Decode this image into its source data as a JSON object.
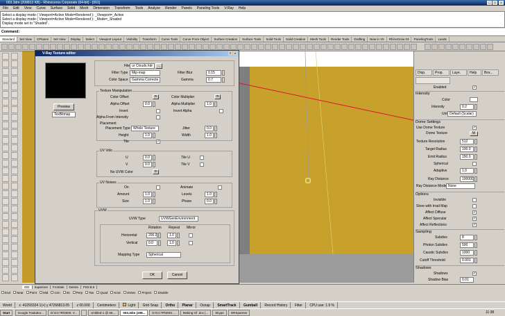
{
  "window": {
    "title": "003.3dm (208813 KB) - Rhinoceros Corporate (64-bit) - [001]"
  },
  "menu": [
    "File",
    "Edit",
    "View",
    "Curve",
    "Surface",
    "Solid",
    "Mesh",
    "Dimension",
    "Transform",
    "Tools",
    "Analyze",
    "Render",
    "Panels",
    "Paneling Tools",
    "V-Ray",
    "Help"
  ],
  "command": {
    "history": [
      "Select a display mode ( Viewport=Active  Mode=Rendered ): _Viewport=_Active",
      "Select a display mode ( Viewport=Active  Mode=Rendered ): _Mode=_Shaded",
      "Display mode set to \"Shaded\"."
    ],
    "prompt": "Command:"
  },
  "tabs": [
    "Standard",
    "Set View",
    "CPlanes",
    "Set View",
    "Display",
    "Select",
    "Viewport Layout",
    "Visibility",
    "Transform",
    "Curve Tools",
    "Curve From Object",
    "Surface Creation",
    "Surface Tools",
    "Solid Tools",
    "Solid Creation",
    "Mesh Tools",
    "Render Tools",
    "Drafting",
    "New in V5",
    "RhinoGrow 03",
    "PanelingTools",
    "Lands"
  ],
  "dialog": {
    "title": "V-Ray Texture editor",
    "preview_label": "Preview",
    "type_value": "TexBitmap",
    "file_label": "File",
    "file_value": "ur Clouds.hdr",
    "browse_label": "...",
    "filter_type_label": "Filter Type",
    "filter_type_value": "Mip-map",
    "filter_blur_label": "Filter Blur",
    "filter_blur_value": "0.15",
    "color_space_label": "Color Space",
    "color_space_value": "Gamma Correcte",
    "gamma_label": "Gamma",
    "gamma_value": "0.7",
    "tex_manip": "Texture Manipulation",
    "color_offset": "Color Offset",
    "color_multiplier": "Color Multiplier",
    "alpha_offset": "Alpha Offset",
    "alpha_offset_value": "0.0",
    "alpha_multiplier": "Alpha Multiplier",
    "alpha_multiplier_value": "1.0",
    "invert": "Invert",
    "invert_alpha": "Invert Alpha",
    "alpha_from_intensity": "Alpha From Intensity",
    "placement": "Placement",
    "placement_type_label": "Placement Type",
    "placement_type_value": "Whole Texture",
    "jitter_label": "Jitter",
    "jitter_value": "0.0",
    "height_label": "Height",
    "height_value": "1.0",
    "width_label": "Width",
    "width_value": "1.0",
    "tile_label": "Tile",
    "uv_volo": "UV Volo",
    "u_label": "U",
    "u_value": "0.0",
    "tile_u": "Tile U",
    "v_label": "V",
    "v_value": "0.0",
    "tile_v": "Tile V",
    "w_label": "W",
    "no_uvw_color": "No UVW Color",
    "m_label": "m",
    "uv_noises": "UV Noises",
    "on_label": "On",
    "animate_label": "Animate",
    "amount_label": "Amount",
    "amount_value": "1.0",
    "levels_label": "Levels",
    "levels_value": "1.0",
    "size_label": "Size",
    "size_value": "1.0",
    "phase_label": "Phase",
    "phase_value": "0.0",
    "uvw": "UVW",
    "uvw_type_label": "UVW Type",
    "uvw_type_value": "UVWGenEnvironment",
    "rotation": "Rotation",
    "repeat": "Repeat",
    "mirror": "Mirror",
    "horizontal": "Horizontal",
    "horizontal_rot": "200.0",
    "horizontal_rep": "1.0",
    "vertical": "Vertical",
    "vertical_rot": "0.0",
    "vertical_rep": "1.0",
    "mapping_type_label": "Mapping Type",
    "mapping_type_value": "Spherical",
    "ok": "OK",
    "cancel": "Cancel"
  },
  "right_panel": {
    "tabs": [
      "Disp.",
      "Prop.",
      "Laye.",
      "Help",
      "Box..."
    ],
    "enabled": "Enabled",
    "intensity_sect": "Intensity",
    "color": "Color",
    "intensity": "Intensity",
    "intensity_value": "0.2",
    "units": "Units",
    "units_value": "Default (Scalar)",
    "dome_sect": "Dome Settings",
    "use_dome": "Use Dome Texture",
    "dome_texture": "Dome Texture",
    "dome_texture_btn": "M",
    "tex_res": "Texture Resolution",
    "tex_res_value": "512",
    "target_radius": "Target Radius",
    "target_radius_value": "100.0",
    "emit_radius": "Emit Radius",
    "emit_radius_value": "150.0",
    "spherical": "Spherical",
    "adaptive": "Adaptive",
    "adaptive_value": "1.0",
    "ray_distance": "Ray Distance",
    "ray_distance_value": "100000",
    "ray_distance_mode": "Ray Distance Mode",
    "ray_distance_mode_value": "None",
    "options_sect": "Options",
    "invisible": "Invisible",
    "store_irr": "Store with Irrad Map",
    "affect_diffuse": "Affect Diffuse",
    "affect_specular": "Affect Specular",
    "affect_reflections": "Affect Reflections",
    "sampling_sect": "Sampling",
    "subdivs": "Subdivs",
    "subdivs_value": "8",
    "photon_subdivs": "Photon Subdivs",
    "photon_subdivs_value": "500",
    "caustic_subdivs": "Caustic Subdivs",
    "caustic_subdivs_value": "1000",
    "cutoff": "Cutoff Threshold",
    "cutoff_value": "0.001",
    "shadows_sect": "Shadows",
    "shadows": "Shadows",
    "shadow_bias": "Shadow Bias",
    "shadow_bias_value": "0.01",
    "shadow_color": "Shadow Color"
  },
  "viewport_tabs": [
    "002",
    "Superiore",
    "Frontale",
    "Destra",
    "FS5 B.6"
  ],
  "osnap": [
    "End",
    "Near",
    "Point",
    "Mid",
    "Cen",
    "Int",
    "Perp",
    "Tan",
    "Quad",
    "Knot",
    "Vertex",
    "Project",
    "Disable"
  ],
  "status": {
    "world": "World",
    "coords": "x -42293324 1(+) y 47266813.05",
    "z": "z 00.000",
    "units": "Centimeters",
    "layer": "Light",
    "grid_snap": "Grid Snap",
    "ortho": "Ortho",
    "planar": "Planar",
    "osnap": "Osnap",
    "smarttrack": "SmartTrack",
    "gumball": "Gumball",
    "record_history": "Record History",
    "filter": "Filter",
    "cpu": "CPU use: 1.9 %"
  },
  "taskbar": {
    "start": "Start",
    "tasks": [
      "Google Traduttor...",
      "D:\\CC?R\\0000. V...",
      "",
      "Untitled-1 @ 66,...",
      "003.3dm (208...",
      "D:\\CC?R\\0001 ...",
      "Making Of .doc [...",
      "Skype",
      "ORSpanner"
    ],
    "clock": "11:38"
  }
}
